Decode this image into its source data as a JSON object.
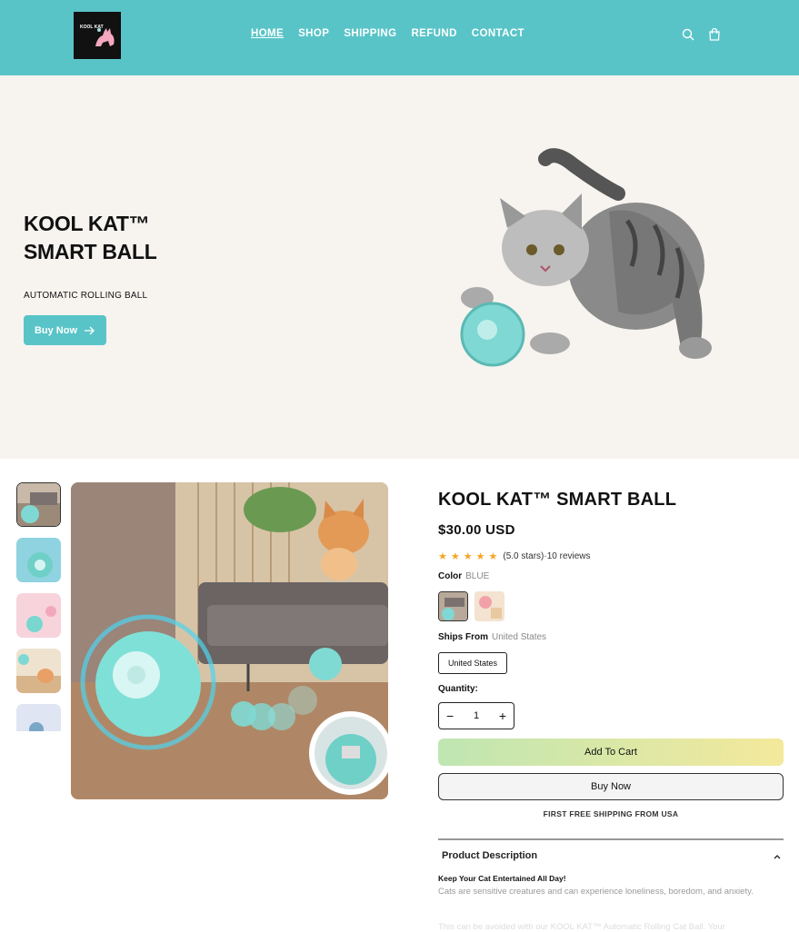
{
  "header": {
    "logo_text": "KOOL KAT",
    "nav": [
      "HOME",
      "SHOP",
      "SHIPPING",
      "REFUND",
      "CONTACT"
    ],
    "icons": [
      "search-icon",
      "cart-icon"
    ],
    "bg_color": "#58c4c8"
  },
  "hero": {
    "title": "KOOL KAT™ SMART BALL",
    "subtitle": "AUTOMATIC ROLLING BALL",
    "button_label": "Buy Now"
  },
  "product": {
    "title": "KOOL KAT™ SMART BALL",
    "price": "$30.00 USD",
    "rating_text": "(5.0 stars)·10 reviews",
    "rating": 5,
    "color_label": "Color",
    "color_value": "BLUE",
    "ships_label": "Ships From",
    "ships_value": "United States",
    "ships_option": "United States",
    "qty_label": "Quantity:",
    "qty_value": "1",
    "add_to_cart": "Add To Cart",
    "buy_now": "Buy Now",
    "free_shipping": "FIRST FREE SHIPPING FROM USA",
    "desc_heading": "Product Description",
    "desc_bold": "Keep Your Cat Entertained All Day!",
    "desc_text": "Cats are sensitive creatures and can experience loneliness, boredom, and anxiety.",
    "desc_fade": "This can be avoided with our KOOL KAT™ Automatic Rolling Cat Ball. Your"
  }
}
